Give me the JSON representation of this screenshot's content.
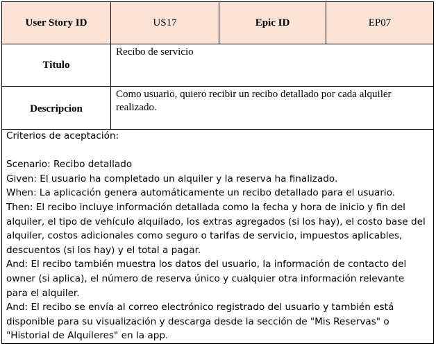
{
  "header": {
    "user_story_label": "User Story ID",
    "user_story_value": "US17",
    "epic_label": "Epic ID",
    "epic_value": "EP07"
  },
  "titulo": {
    "label": "Titulo",
    "value": "Recibo de servicio"
  },
  "descripcion": {
    "label": "Descripcion",
    "value": "Como usuario, quiero recibir un recibo detallado por cada alquiler realizado."
  },
  "criteria": {
    "heading": "Criterios de aceptación:",
    "scenario": "Scenario: Recibo detallado",
    "given": "Given: El usuario ha completado un alquiler y la reserva ha finalizado.",
    "when": "When: La aplicación genera automáticamente un recibo detallado para el usuario.",
    "then": "Then: El recibo incluye información detallada como la fecha y hora de inicio y fin del alquiler, el tipo de vehículo alquilado, los extras agregados (si los hay), el costo base del alquiler, costos adicionales como seguro o tarifas de servicio, impuestos aplicables, descuentos (si los hay) y el total a pagar.",
    "and1": "And: El recibo también muestra los datos del usuario, la información de contacto del owner (si aplica), el número de reserva único y cualquier otra información relevante para el alquiler.",
    "and2": "And: El recibo se envía al correo electrónico registrado del usuario y también está disponible para su visualización y descarga desde la sección de \"Mis Reservas\" o \"Historial de Alquileres\" en la app."
  }
}
